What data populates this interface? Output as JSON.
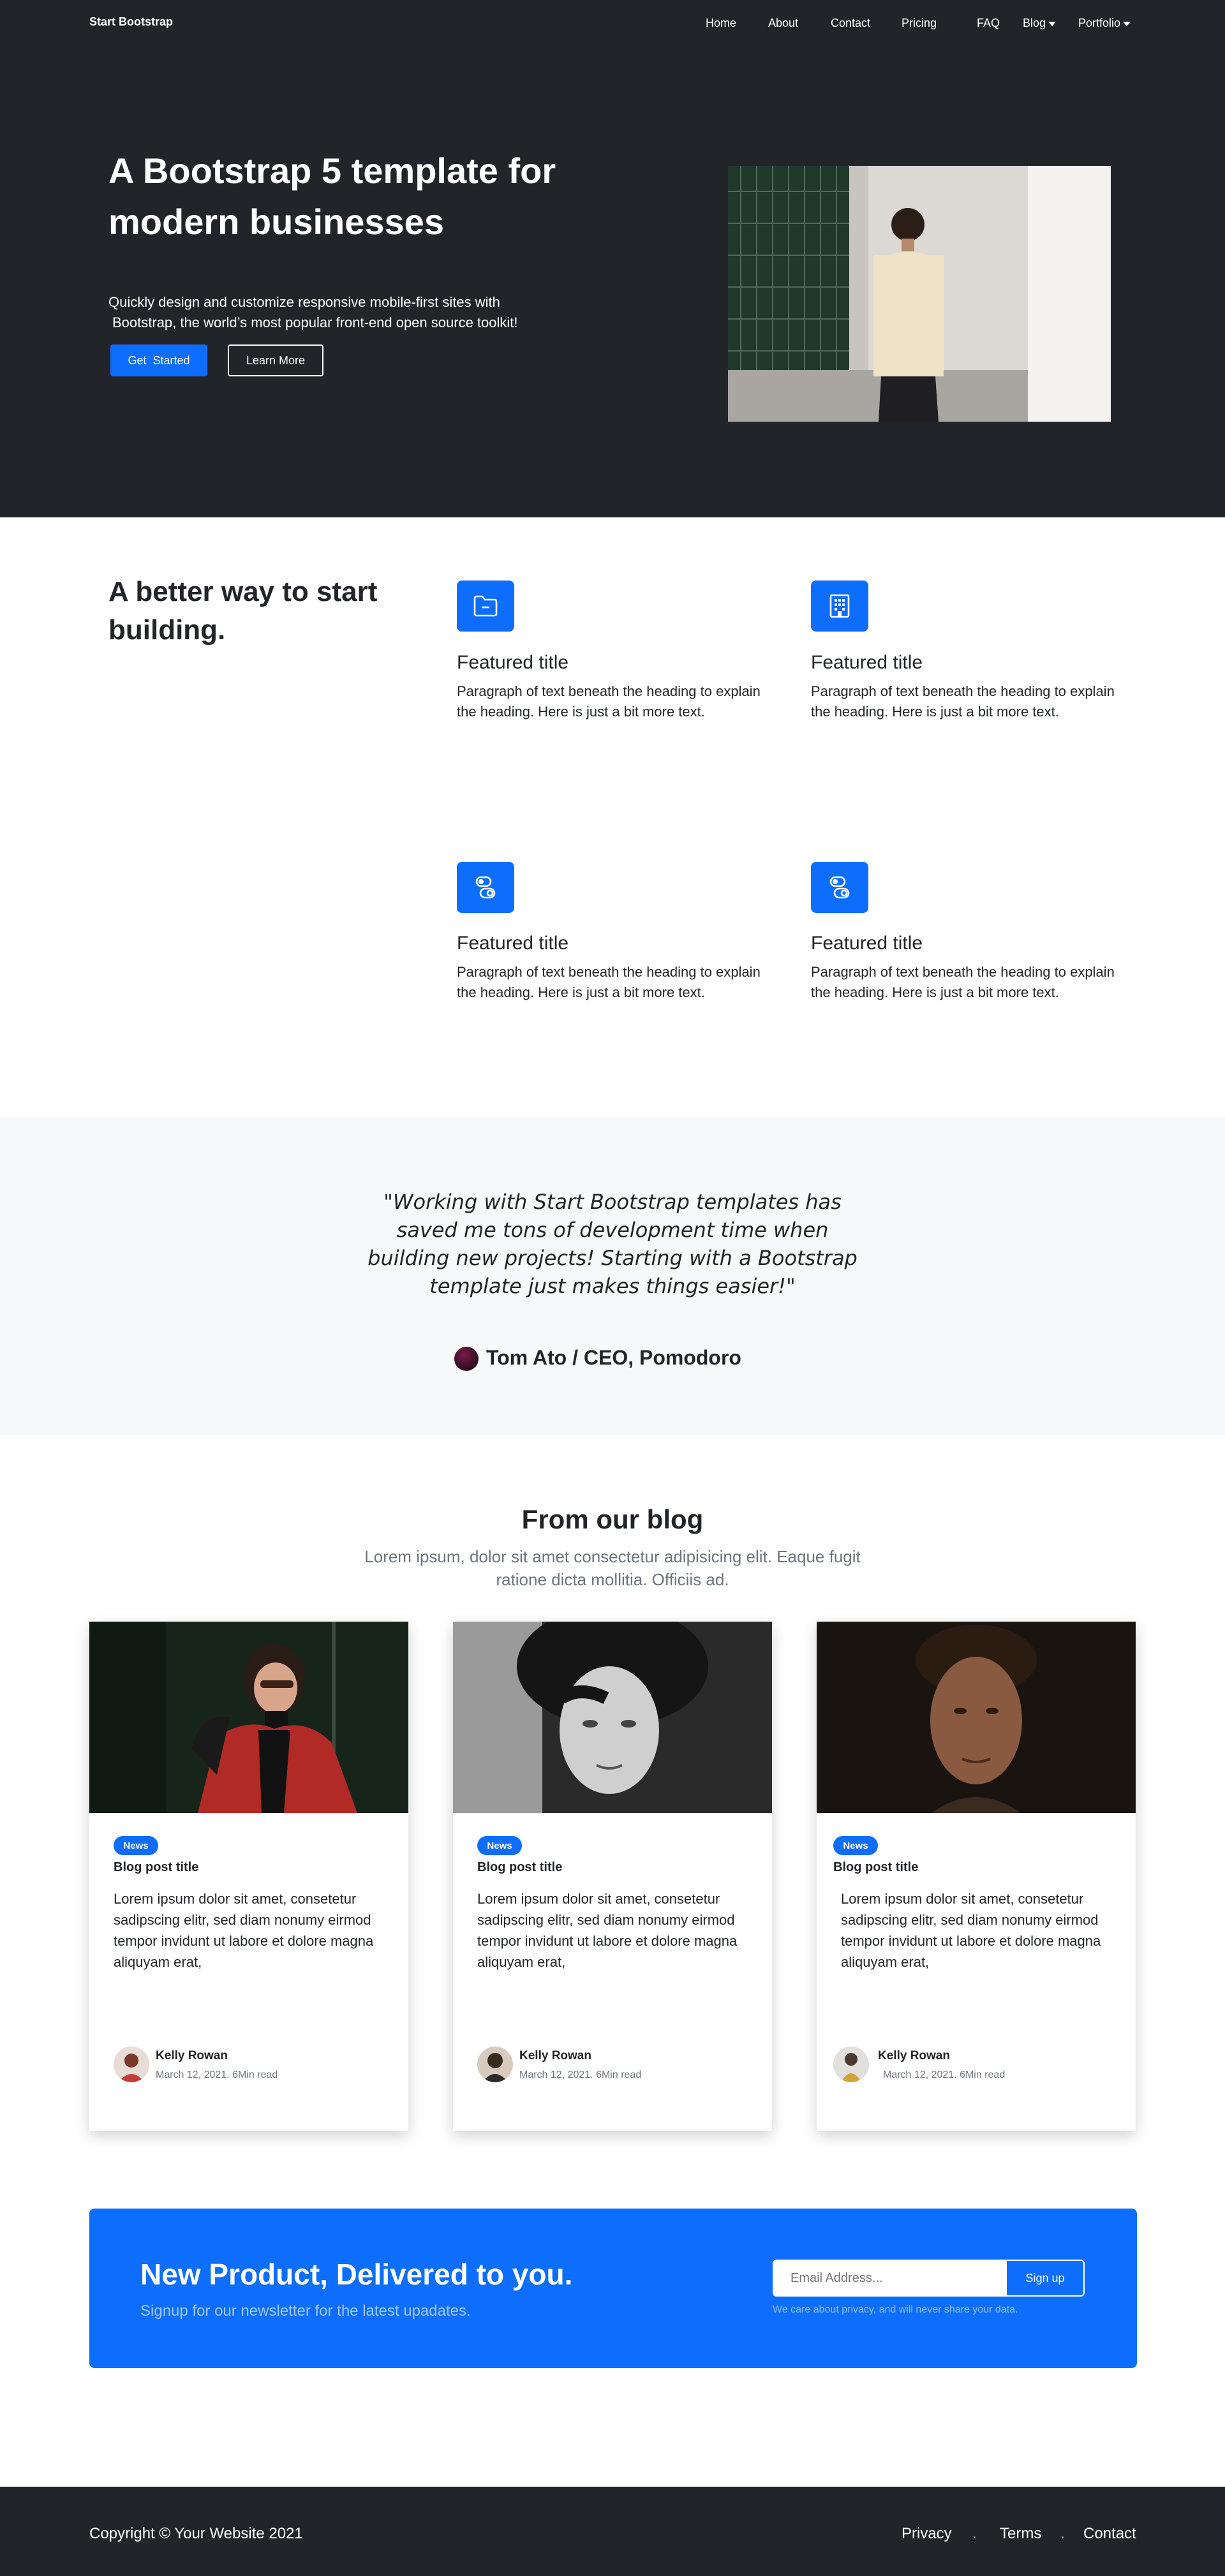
{
  "nav": {
    "brand": "Start Bootstrap",
    "links": [
      "Home",
      "About",
      "Contact",
      "Pricing",
      "FAQ"
    ],
    "dropdowns": [
      "Blog",
      "Portfolio"
    ]
  },
  "hero": {
    "title": "A Bootstrap 5 template for modern businesses",
    "subtitle_line1": "Quickly design and customize responsive mobile-first sites with",
    "subtitle_line2": "Bootstrap, the world’s most popular front-end open source toolkit!",
    "primary_button": "Get  Started",
    "secondary_button": "Learn More"
  },
  "features": {
    "heading": "A better way to start building.",
    "items": [
      {
        "icon": "folder-icon",
        "title": "Featured title",
        "text": "Paragraph of text beneath the heading to explain the heading. Here is just a bit more text."
      },
      {
        "icon": "building-icon",
        "title": "Featured title",
        "text": "Paragraph of text beneath the heading to explain the heading. Here is just a bit more text."
      },
      {
        "icon": "toggles-icon",
        "title": "Featured title",
        "text": "Paragraph of text beneath the heading to explain the heading. Here is just a bit more text."
      },
      {
        "icon": "toggles-icon",
        "title": "Featured title",
        "text": "Paragraph of text beneath the heading to explain the heading. Here is just a bit more text."
      }
    ]
  },
  "testimonial": {
    "quote": "\"Working with Start Bootstrap templates has saved me tons of development time when building new projects! Starting with a Bootstrap template just makes things easier!\"",
    "author": "Tom Ato / CEO, Pomodoro"
  },
  "blog": {
    "title": "From our blog",
    "subtitle": "Lorem ipsum, dolor sit amet consectetur adipisicing elit. Eaque fugit ratione dicta mollitia. Officiis ad.",
    "posts": [
      {
        "badge": "News",
        "title": "Blog post title",
        "text": "Lorem ipsum dolor sit amet, consetetur sadipscing elitr, sed diam nonumy eirmod tempor invidunt ut labore et dolore magna aliquyam erat,",
        "author": "Kelly Rowan",
        "meta": "March 12, 2021. 6Min read"
      },
      {
        "badge": "News",
        "title": "Blog post title",
        "text": "Lorem ipsum dolor sit amet, consetetur sadipscing elitr, sed diam nonumy eirmod tempor invidunt ut labore et dolore magna aliquyam erat,",
        "author": "Kelly Rowan",
        "meta": "March 12, 2021. 6Min read"
      },
      {
        "badge": "News",
        "title": "Blog post title",
        "text": "Lorem ipsum dolor sit amet, consetetur sadipscing elitr, sed diam nonumy eirmod tempor invidunt ut labore et dolore magna aliquyam erat,",
        "author": "Kelly Rowan",
        "meta": "March 12, 2021. 6Min read"
      }
    ]
  },
  "newsletter": {
    "title": "New Product, Delivered to you.",
    "subtitle": "Signup for our newsletter for the latest upadates.",
    "email_placeholder": "Email Address...",
    "button": "Sign up",
    "privacy": "We care about privacy, and will never share your data."
  },
  "footer": {
    "copyright": "Copyright © Your Website 2021",
    "links": [
      "Privacy",
      "Terms",
      "Contact"
    ],
    "separator": "."
  },
  "colors": {
    "dark": "#212529",
    "primary": "#0d6efd",
    "light": "#f8f9fa",
    "muted": "#6c757d"
  }
}
